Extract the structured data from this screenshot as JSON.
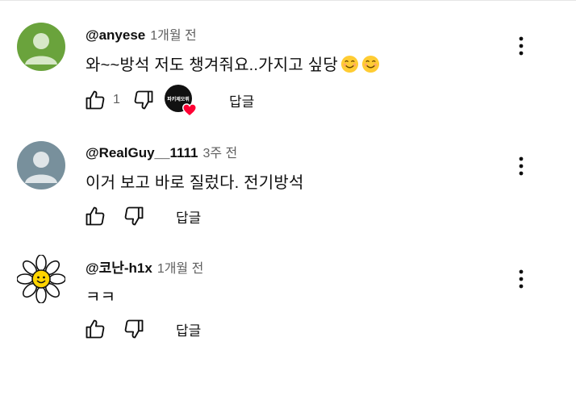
{
  "comments": [
    {
      "author": "@anyese",
      "time": "1개월 전",
      "text": "와~~방석  저도 챙겨줘요..가지고 싶당",
      "emojis": [
        "smiling-face-emoji",
        "smiling-face-emoji"
      ],
      "like_count": "1",
      "creator_badge_text": "파키제모뤼",
      "reply_label": "답글",
      "avatar_color": "#6aa33c"
    },
    {
      "author": "@RealGuy__1111",
      "time": "3주 전",
      "text": "이거 보고 바로 질렀다. 전기방석",
      "reply_label": "답글",
      "avatar_color": "#78909c"
    },
    {
      "author": "@코난-h1x",
      "time": "1개월 전",
      "text": "ㅋㅋ",
      "reply_label": "답글",
      "avatar_color": "#ffffff"
    }
  ]
}
